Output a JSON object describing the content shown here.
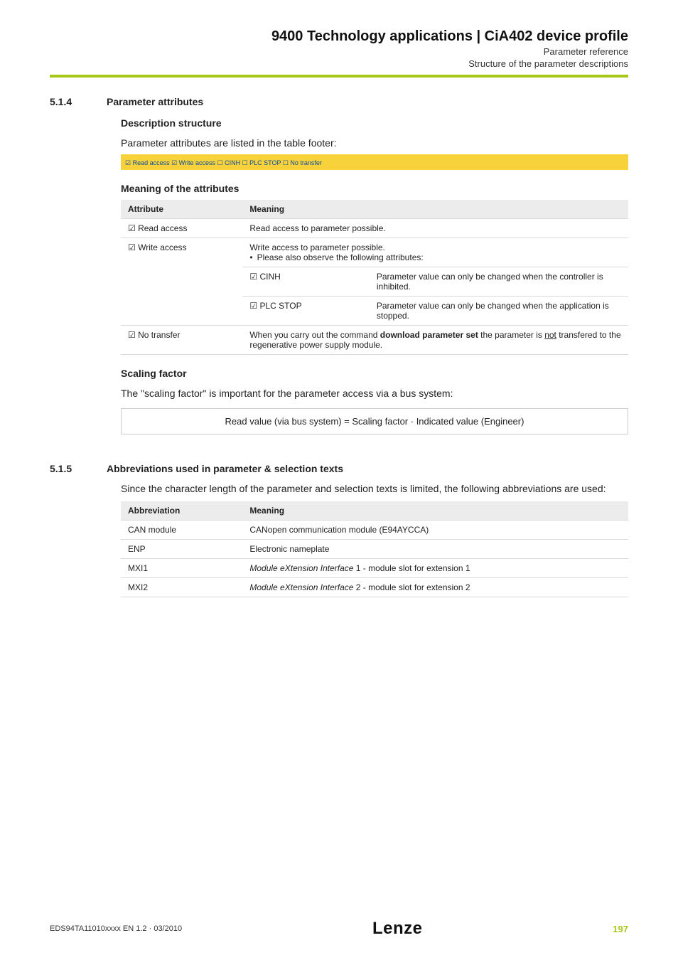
{
  "header": {
    "title": "9400 Technology applications | CiA402 device profile",
    "sub1": "Parameter reference",
    "sub2": "Structure of the parameter descriptions"
  },
  "sec514": {
    "num": "5.1.4",
    "title": "Parameter attributes",
    "desc_head": "Description structure",
    "desc_para": "Parameter attributes are listed in the table footer:",
    "bar": "☑ Read access   ☑ Write access   ☐ CINH   ☐ PLC STOP   ☐ No transfer",
    "mean_head": "Meaning of the attributes",
    "tbl": {
      "h1": "Attribute",
      "h2": "Meaning",
      "r1c1": "☑ Read access",
      "r1c2": "Read access to parameter possible.",
      "r2c1": "☑ Write access",
      "r2c2a": "Write access to parameter possible.",
      "r2c2b": "Please also observe the following attributes:",
      "r3c1": "☑ CINH",
      "r3c2": "Parameter value can only be changed when the controller is inhibited.",
      "r4c1": "☑ PLC STOP",
      "r4c2": "Parameter value can only be changed when the application is stopped.",
      "r5c1": "☑ No transfer",
      "r5c2a": "When you carry out the command ",
      "r5c2b": "download parameter set",
      "r5c2c": " the parameter is ",
      "r5c2d": "not",
      "r5c2e": " transfered to the regenerative power supply module."
    },
    "scale_head": "Scaling factor",
    "scale_para": "The \"scaling factor\" is important for the parameter access via a bus system:",
    "formula": "Read value (via bus system)  =  Scaling factor · Indicated value (Engineer)"
  },
  "sec515": {
    "num": "5.1.5",
    "title": "Abbreviations used in parameter & selection texts",
    "para": "Since the character length of the parameter and selection texts is limited, the following abbreviations are used:",
    "tbl": {
      "h1": "Abbreviation",
      "h2": "Meaning",
      "r1c1": "CAN module",
      "r1c2": "CANopen communication module (E94AYCCA)",
      "r2c1": "ENP",
      "r2c2": "Electronic nameplate",
      "r3c1": "MXI1",
      "r3c2a": "Module eXtension Interface",
      "r3c2b": " 1 - module slot for extension 1",
      "r4c1": "MXI2",
      "r4c2a": "Module eXtension Interface",
      "r4c2b": " 2 - module slot for extension 2"
    }
  },
  "footer": {
    "docid": "EDS94TA11010xxxx EN 1.2 · 03/2010",
    "logo": "Lenze",
    "page": "197"
  }
}
